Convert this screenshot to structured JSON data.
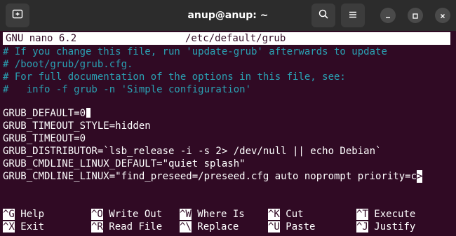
{
  "window": {
    "title": "anup@anup: ~"
  },
  "nano": {
    "version": "GNU nano 6.2",
    "filename": "/etc/default/grub"
  },
  "comments": [
    "# If you change this file, run 'update-grub' afterwards to update",
    "# /boot/grub/grub.cfg.",
    "# For full documentation of the options in this file, see:",
    "#   info -f grub -n 'Simple configuration'"
  ],
  "config": {
    "line1": "GRUB_DEFAULT=0",
    "line2": "GRUB_TIMEOUT_STYLE=hidden",
    "line3": "GRUB_TIMEOUT=0",
    "line4": "GRUB_DISTRIBUTOR=`lsb_release -i -s 2> /dev/null || echo Debian`",
    "line5": "GRUB_CMDLINE_LINUX_DEFAULT=\"quiet splash\"",
    "line6": "GRUB_CMDLINE_LINUX=\"find_preseed=/preseed.cfg auto noprompt priority=c",
    "overflow": ">"
  },
  "shortcuts": {
    "help": {
      "key": "^G",
      "label": "Help"
    },
    "exit": {
      "key": "^X",
      "label": "Exit"
    },
    "write_out": {
      "key": "^O",
      "label": "Write Out"
    },
    "read_file": {
      "key": "^R",
      "label": "Read File"
    },
    "where_is": {
      "key": "^W",
      "label": "Where Is"
    },
    "replace": {
      "key": "^\\",
      "label": "Replace"
    },
    "cut": {
      "key": "^K",
      "label": "Cut"
    },
    "paste": {
      "key": "^U",
      "label": "Paste"
    },
    "execute": {
      "key": "^T",
      "label": "Execute"
    },
    "justify": {
      "key": "^J",
      "label": "Justify"
    }
  },
  "icons": {
    "new_tab": "new-tab-icon",
    "search": "search-icon",
    "menu": "hamburger-menu-icon",
    "minimize": "minimize-icon",
    "maximize": "maximize-icon",
    "close": "close-icon"
  },
  "colors": {
    "terminal_bg": "#300a24",
    "comment": "#2aa1b3",
    "titlebar": "#2c2c2c"
  }
}
